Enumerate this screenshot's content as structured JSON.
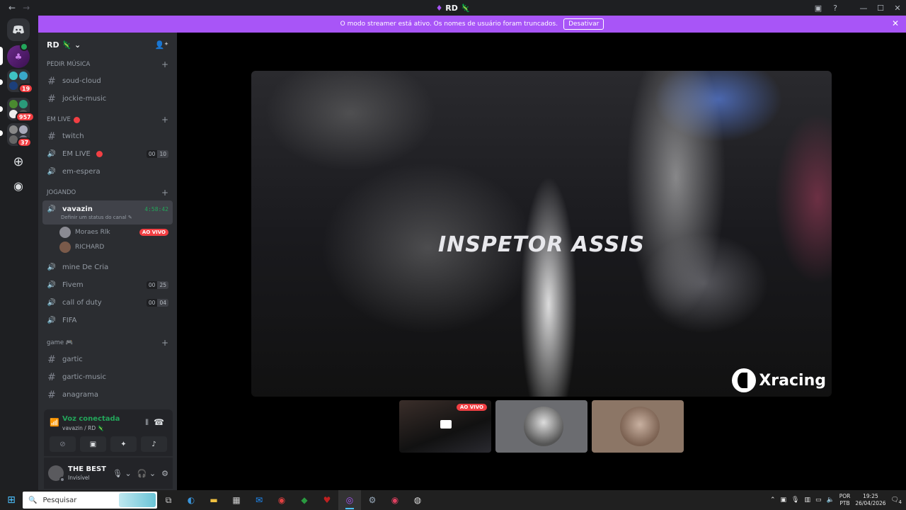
{
  "window": {
    "title": "RD 🦎",
    "nav_back": "←",
    "nav_forward": "→"
  },
  "rail": {
    "badges": [
      "19",
      "957",
      "37"
    ]
  },
  "banner": {
    "text": "O modo streamer está ativo. Os nomes de usuário foram truncados.",
    "button": "Desativar",
    "close": "✕"
  },
  "guild": {
    "name": "RD 🦎",
    "chevron": "⌄"
  },
  "channels": {
    "cat1": {
      "label": "PEDIR MÚSICA",
      "items": [
        "soud-cloud",
        "jockie-music"
      ]
    },
    "cat2": {
      "label": "EM LIVE",
      "items": [
        "twitch",
        "EM LIVE",
        "em-espera"
      ],
      "em_live_count": [
        "00",
        "10"
      ]
    },
    "cat3": {
      "label": "JOGANDO",
      "active": {
        "name": "vavazin",
        "timer": "4:58:42",
        "status": "Definir um status do canal"
      },
      "members": [
        {
          "name": "Moraes Rlk",
          "live": "AO VIVO"
        },
        {
          "name": "RICHARD",
          "live": ""
        }
      ],
      "items": [
        {
          "name": "mine De Cria",
          "count": null
        },
        {
          "name": "Fivem",
          "count": [
            "00",
            "25"
          ]
        },
        {
          "name": "call of duty",
          "count": [
            "00",
            "04"
          ]
        },
        {
          "name": "FIFA",
          "count": null
        }
      ]
    },
    "cat4": {
      "label": "game 🎮",
      "items": [
        "gartic",
        "gartic-music",
        "anagrama"
      ]
    }
  },
  "voice": {
    "status": "Voz conectada",
    "sub": "vavazin / RD 🦎"
  },
  "user": {
    "name": "THE BEST",
    "status": "Invisível"
  },
  "stream": {
    "title": "INSPETOR ASSIS",
    "brand": "Xracing",
    "thumb_live": "AO VIVO"
  },
  "taskbar": {
    "search_placeholder": "Pesquisar",
    "lang1": "POR",
    "lang2": "PTB",
    "time": "19:25",
    "date": "26/04/2026",
    "notif": "4"
  },
  "colors": {
    "banner": "#a855f7",
    "live_red": "#f23f43",
    "voice_green": "#23a55a"
  }
}
